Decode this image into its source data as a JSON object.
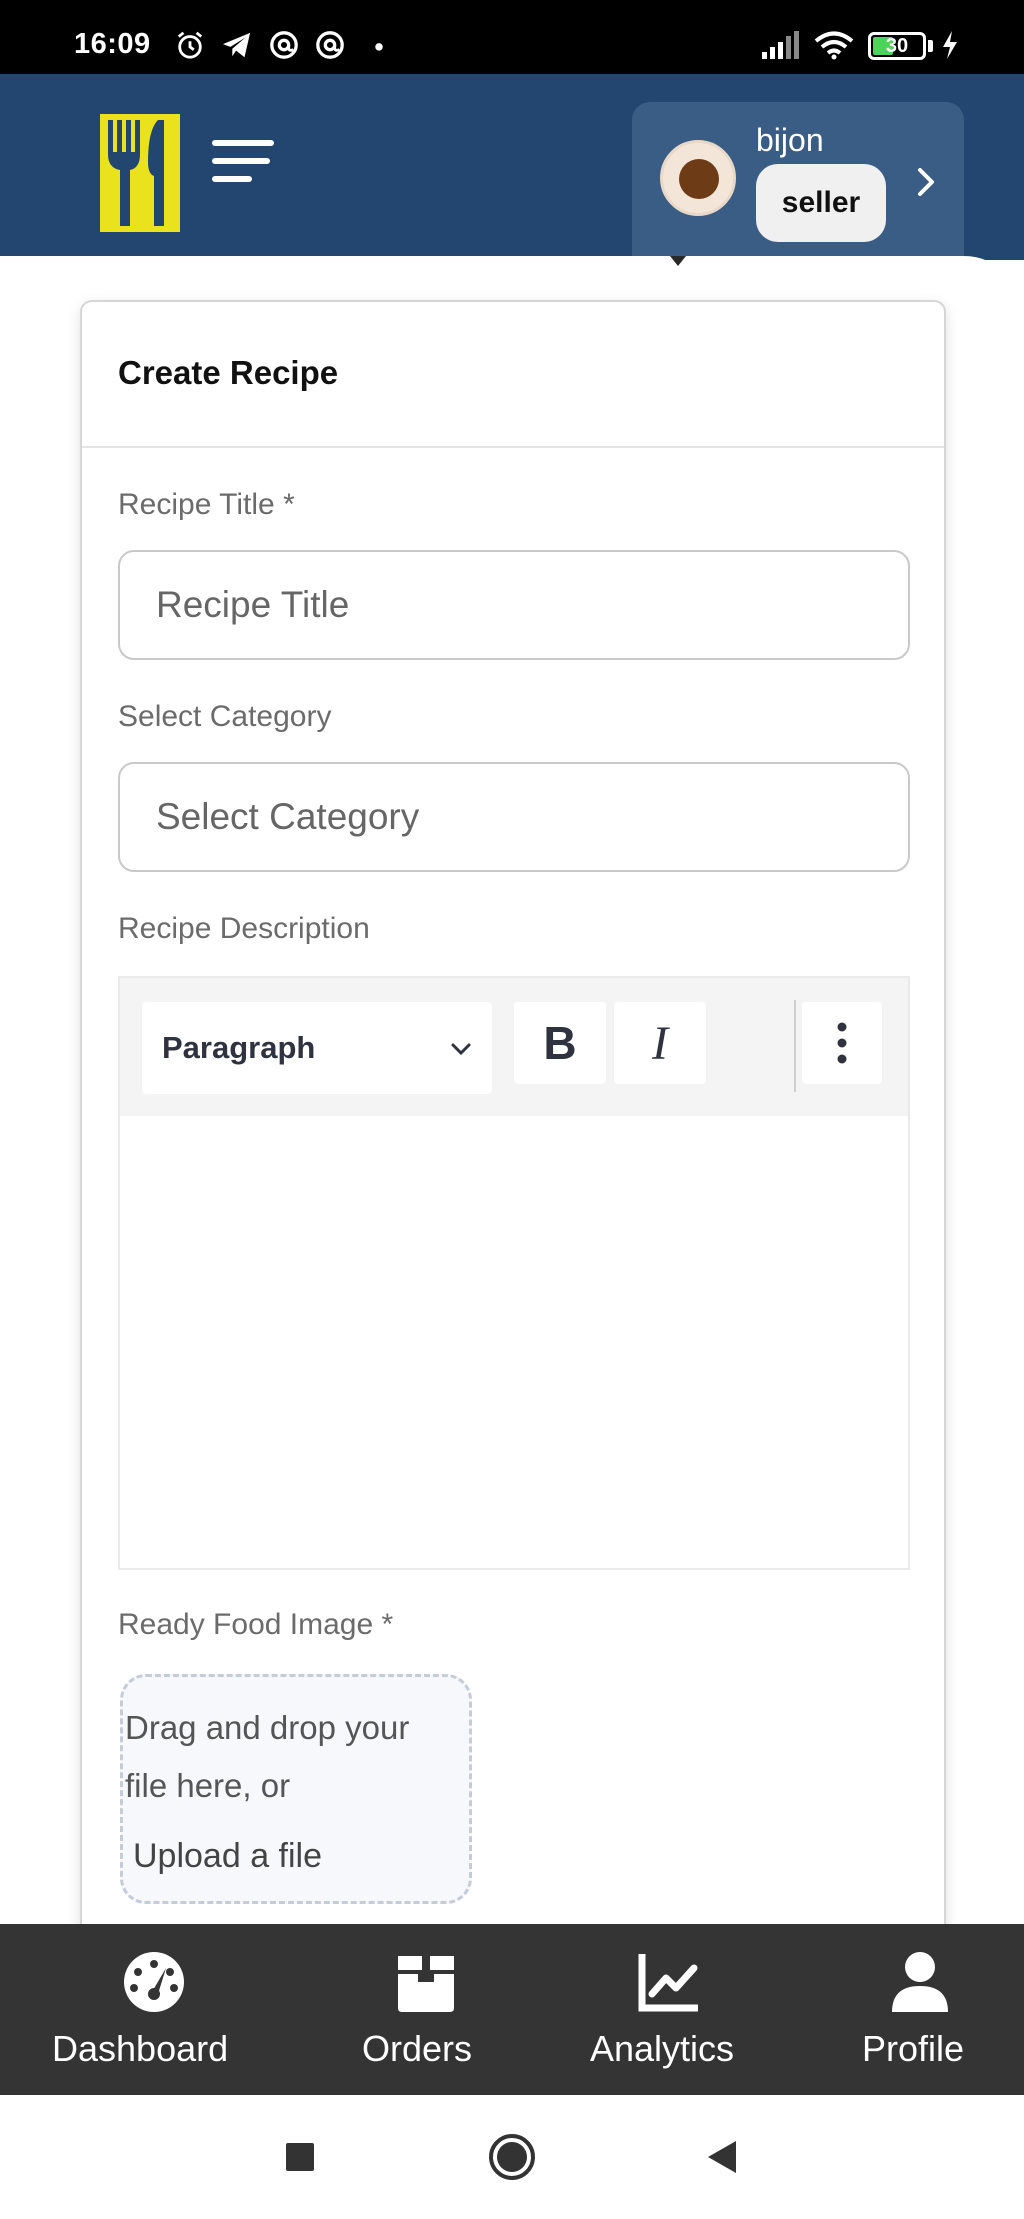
{
  "status_bar": {
    "time": "16:09",
    "battery": "30",
    "icons": [
      "alarm-icon",
      "telegram-icon",
      "at-sign-icon",
      "at-sign-icon",
      "dot-icon",
      "signal-icon",
      "wifi-icon",
      "battery-icon",
      "charging-icon"
    ]
  },
  "header": {
    "logo": "fork-knife-logo",
    "menu_icon": "hamburger-menu-icon",
    "user": {
      "name": "bijon",
      "role": "seller",
      "chevron_icon": "chevron-right-icon"
    }
  },
  "form": {
    "title": "Create Recipe",
    "recipe_title": {
      "label": "Recipe Title *",
      "placeholder": "Recipe Title",
      "value": ""
    },
    "category": {
      "label": "Select Category",
      "placeholder": "Select Category",
      "value": ""
    },
    "description": {
      "label": "Recipe Description",
      "toolbar": {
        "format": "Paragraph",
        "bold": "B",
        "italic": "I",
        "more_icon": "more-vertical-icon"
      }
    },
    "image": {
      "label": "Ready Food Image *",
      "drop_text": "Drag and drop your file here, or",
      "upload_text": "Upload a file"
    }
  },
  "bottom_nav": [
    {
      "label": "Dashboard",
      "icon": "speedometer-icon"
    },
    {
      "label": "Orders",
      "icon": "box-icon"
    },
    {
      "label": "Analytics",
      "icon": "line-chart-icon"
    },
    {
      "label": "Profile",
      "icon": "user-icon"
    }
  ],
  "system_nav": [
    "recents-square-icon",
    "home-circle-icon",
    "back-triangle-icon"
  ],
  "colors": {
    "header_bg": "#224670",
    "user_card_bg": "#3a5d85",
    "logo": "#e9e21d",
    "bottom_nav_bg": "#343434"
  }
}
